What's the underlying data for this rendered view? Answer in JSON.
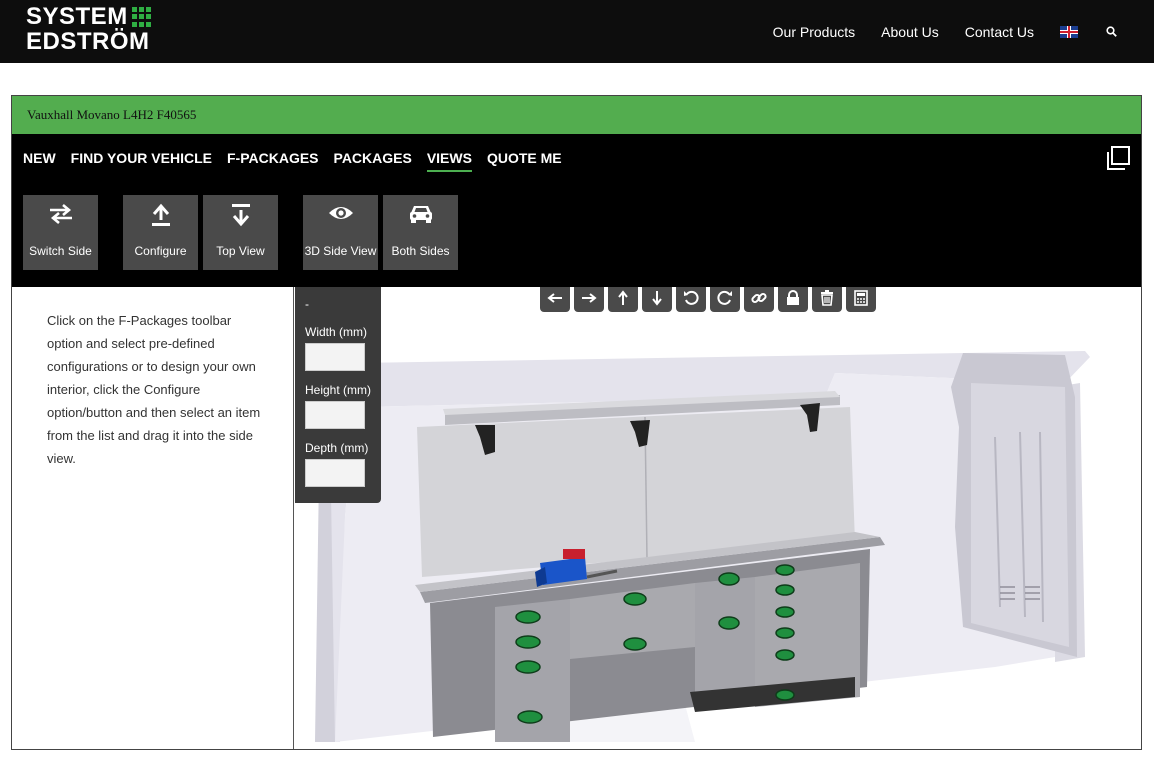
{
  "header": {
    "logo_line1": "SYSTEM",
    "logo_line2": "EDSTRÖM",
    "nav": [
      "Our Products",
      "About Us",
      "Contact Us"
    ],
    "language_icon": "uk-flag-icon",
    "search_icon": "search-icon"
  },
  "vehicle": {
    "name": "Vauxhall Movano L4H2 F40565"
  },
  "menu": {
    "items": [
      "NEW",
      "FIND YOUR VEHICLE",
      "F-PACKAGES",
      "PACKAGES",
      "VIEWS",
      "QUOTE ME"
    ],
    "active": "VIEWS"
  },
  "tools": {
    "switch_side": "Switch Side",
    "configure": "Configure",
    "top_view": "Top View",
    "side_view_3d": "3D Side View",
    "both_sides": "Both Sides"
  },
  "instructions": "Click on the F-Packages toolbar option and select pre-defined configurations or to design your own interior, click the Configure option/button and then select an item from the list and drag it into the side view.",
  "dimensions": {
    "title": "-",
    "width_label": "Width (mm)",
    "height_label": "Height (mm)",
    "depth_label": "Depth (mm)",
    "width_value": "",
    "height_value": "",
    "depth_value": ""
  },
  "view_tools": [
    "arrow-left-icon",
    "arrow-right-icon",
    "arrow-up-icon",
    "arrow-down-icon",
    "rotate-ccw-icon",
    "rotate-cw-icon",
    "link-icon",
    "lock-icon",
    "trash-icon",
    "calculator-icon"
  ],
  "colors": {
    "accent_green": "#53ad4f",
    "header_bg": "#0d0d0d",
    "button_bg": "#4a4a4a"
  }
}
